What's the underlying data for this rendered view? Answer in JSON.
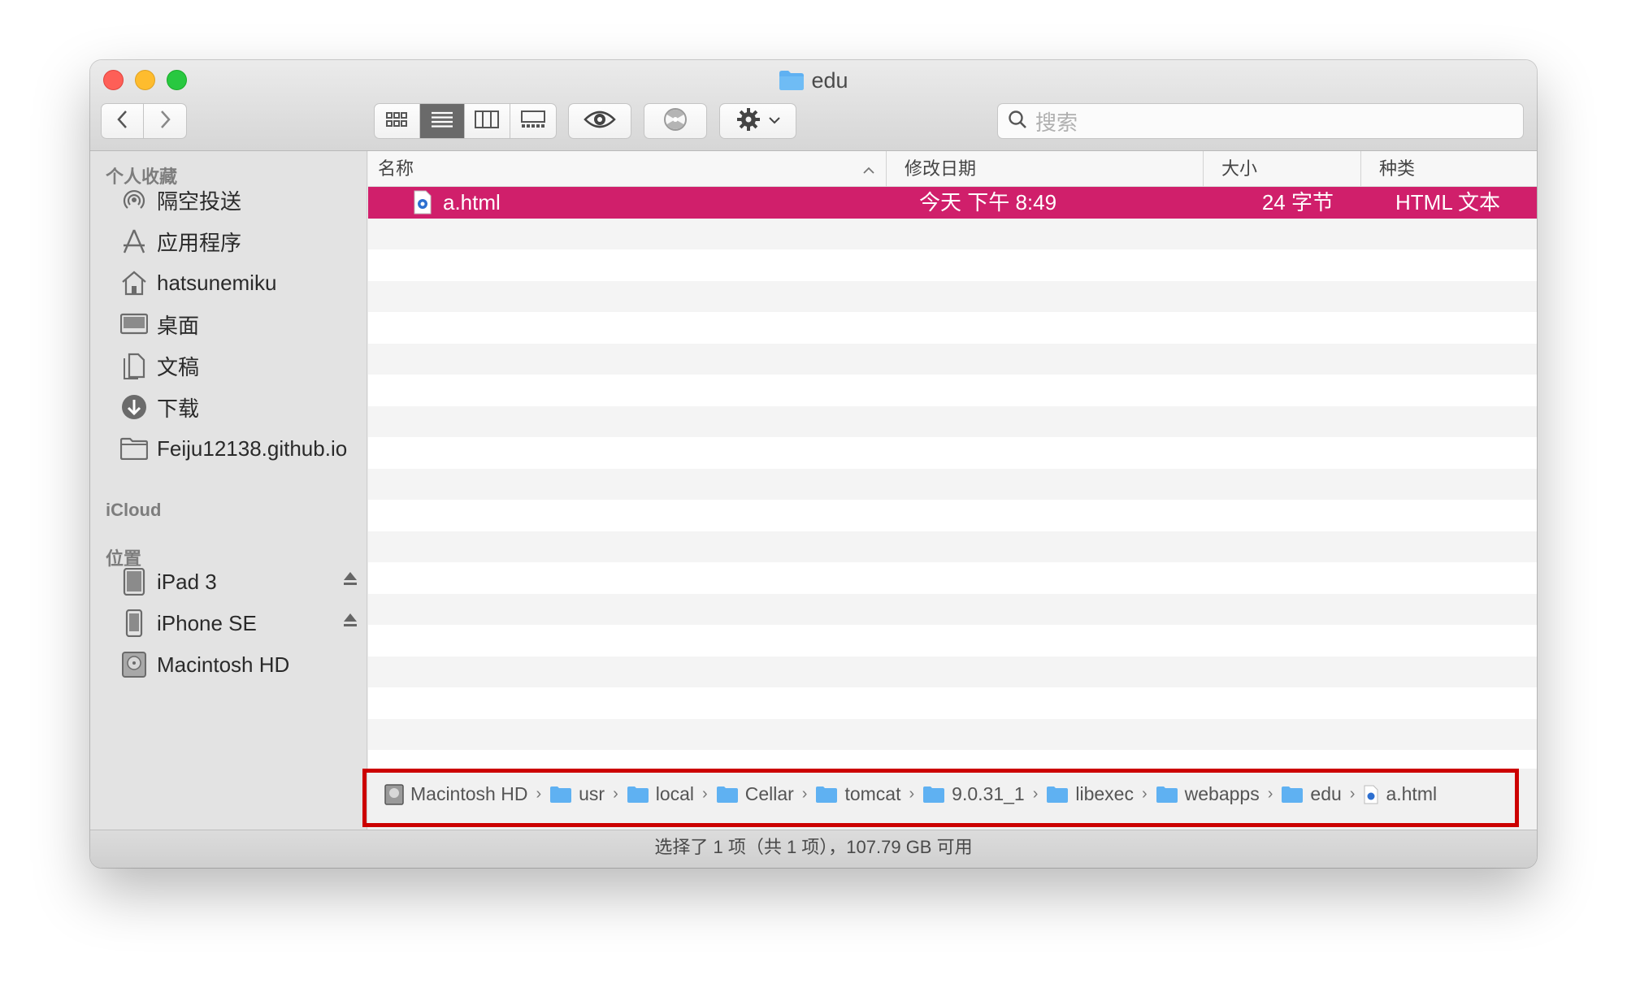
{
  "window": {
    "title": "edu"
  },
  "toolbar": {
    "search_placeholder": "搜索",
    "view_modes": [
      "icon-view",
      "list-view",
      "column-view",
      "gallery-view"
    ],
    "active_view": "list-view"
  },
  "sidebar": {
    "favorites_header": "个人收藏",
    "favorites": [
      {
        "label": "隔空投送",
        "icon": "airdrop-icon"
      },
      {
        "label": "应用程序",
        "icon": "applications-icon"
      },
      {
        "label": "hatsunemiku",
        "icon": "home-icon"
      },
      {
        "label": "桌面",
        "icon": "desktop-icon"
      },
      {
        "label": "文稿",
        "icon": "documents-icon"
      },
      {
        "label": "下载",
        "icon": "downloads-icon"
      },
      {
        "label": "Feiju12138.github.io",
        "icon": "folder-icon"
      }
    ],
    "icloud_header": "iCloud",
    "locations_header": "位置",
    "locations": [
      {
        "label": "iPad 3",
        "icon": "ipad-icon",
        "ejectable": true
      },
      {
        "label": "iPhone SE",
        "icon": "iphone-icon",
        "ejectable": true
      },
      {
        "label": "Macintosh HD",
        "icon": "hard-drive-icon",
        "ejectable": false
      }
    ]
  },
  "columns": {
    "name": "名称",
    "modified": "修改日期",
    "size": "大小",
    "kind": "种类"
  },
  "files": [
    {
      "name": "a.html",
      "modified": "今天 下午 8:49",
      "size": "24 字节",
      "kind": "HTML 文本",
      "selected": true
    }
  ],
  "pathbar": [
    {
      "label": "Macintosh HD",
      "icon": "hard-drive-icon"
    },
    {
      "label": "usr",
      "icon": "folder-icon"
    },
    {
      "label": "local",
      "icon": "folder-icon"
    },
    {
      "label": "Cellar",
      "icon": "folder-icon"
    },
    {
      "label": "tomcat",
      "icon": "folder-icon"
    },
    {
      "label": "9.0.31_1",
      "icon": "folder-icon"
    },
    {
      "label": "libexec",
      "icon": "folder-icon"
    },
    {
      "label": "webapps",
      "icon": "folder-icon"
    },
    {
      "label": "edu",
      "icon": "folder-icon"
    },
    {
      "label": "a.html",
      "icon": "html-file-icon"
    }
  ],
  "statusbar": {
    "text": "选择了 1 项（共 1 项），107.79 GB 可用"
  },
  "colors": {
    "selection": "#d01f6b",
    "folder": "#5fb1f2",
    "highlight_box": "#cc0000"
  }
}
